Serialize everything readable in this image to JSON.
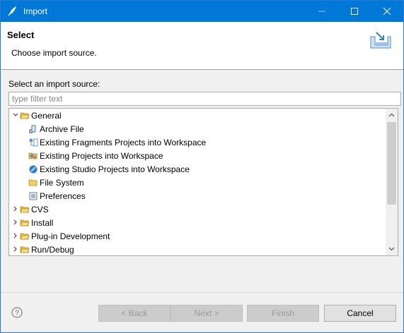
{
  "window": {
    "title": "Import",
    "accent": "#0078d7"
  },
  "header": {
    "title": "Select",
    "description": "Choose import source."
  },
  "body": {
    "source_label": "Select an import source:",
    "filter_placeholder": "type filter text",
    "filter_value": ""
  },
  "tree": {
    "items": [
      {
        "label": "General",
        "expanded": true,
        "level": 0,
        "icon": "folder-open-icon"
      },
      {
        "label": "Archive File",
        "level": 1,
        "icon": "archive-icon"
      },
      {
        "label": "Existing Fragments Projects into Workspace",
        "level": 1,
        "icon": "fragments-icon"
      },
      {
        "label": "Existing Projects into Workspace",
        "level": 1,
        "icon": "projects-icon"
      },
      {
        "label": "Existing Studio Projects into Workspace",
        "level": 1,
        "icon": "studio-icon"
      },
      {
        "label": "File System",
        "level": 1,
        "icon": "folder-icon"
      },
      {
        "label": "Preferences",
        "level": 1,
        "icon": "preferences-icon"
      },
      {
        "label": "CVS",
        "expanded": false,
        "level": 0,
        "icon": "folder-closed-icon"
      },
      {
        "label": "Install",
        "expanded": false,
        "level": 0,
        "icon": "folder-closed-icon"
      },
      {
        "label": "Plug-in Development",
        "expanded": false,
        "level": 0,
        "icon": "folder-closed-icon"
      },
      {
        "label": "Run/Debug",
        "expanded": false,
        "level": 0,
        "icon": "folder-closed-icon"
      }
    ]
  },
  "footer": {
    "back_label": "< Back",
    "next_label": "Next >",
    "finish_label": "Finish",
    "cancel_label": "Cancel"
  }
}
